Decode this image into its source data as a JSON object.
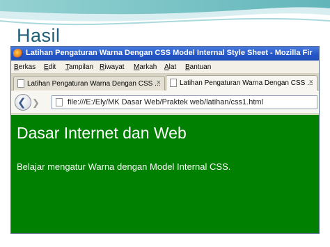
{
  "slide": {
    "title": "Hasil"
  },
  "browser": {
    "window_title": "Latihan Pengaturan Warna Dengan CSS Model Internal Style Sheet - Mozilla Fir",
    "menu": [
      "Berkas",
      "Edit",
      "Tampilan",
      "Riwayat",
      "Markah",
      "Alat",
      "Bantuan"
    ],
    "tabs": [
      {
        "label": "Latihan Pengaturan Warna Dengan CSS ...",
        "close": "×",
        "active": false
      },
      {
        "label": "Latihan Pengaturan Warna Dengan CSS ...",
        "close": "×",
        "active": true
      }
    ],
    "nav": {
      "back_icon": "back-arrow-icon",
      "forward_icon": "forward-arrow-icon"
    },
    "url": "file:///E:/Ely/MK Dasar Web/Praktek web/latihan/css1.html"
  },
  "page": {
    "heading": "Dasar Internet dan Web",
    "paragraph": "Belajar mengatur Warna dengan Model Internal CSS.",
    "background_color": "#008000",
    "text_color": "#ffffff"
  },
  "colors": {
    "titlebar": "#2456c9",
    "slide_title": "#1f5f7a"
  }
}
